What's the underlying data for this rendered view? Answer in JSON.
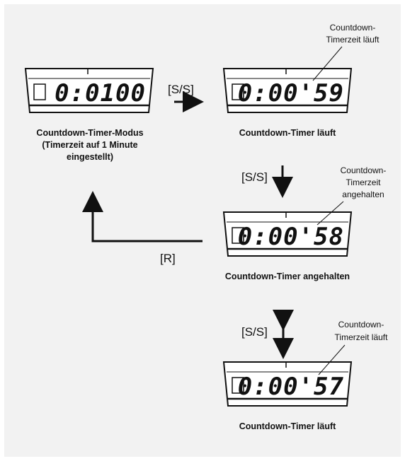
{
  "displays": [
    {
      "id": "d1",
      "time": "0:0100"
    },
    {
      "id": "d2",
      "time": "0:00'59"
    },
    {
      "id": "d3",
      "time": "0:00'58"
    },
    {
      "id": "d4",
      "time": "0:00'57"
    }
  ],
  "captions": {
    "mode_line1": "Countdown-Timer-Modus",
    "mode_line2": "(Timerzeit auf 1 Minute",
    "mode_line3": "eingestellt)",
    "running1": "Countdown-Timer läuft",
    "stopped": "Countdown-Timer angehalten",
    "running2": "Countdown-Timer läuft"
  },
  "button_labels": {
    "ss_right": "[S/S]",
    "ss_down": "[S/S]",
    "ss_updown": "[S/S]",
    "reset": "[R]"
  },
  "callouts": {
    "c1_line1": "Countdown-",
    "c1_line2": "Timerzeit läuft",
    "c2_line1": "Countdown-",
    "c2_line2": "Timerzeit",
    "c2_line3": "angehalten",
    "c3_line1": "Countdown-",
    "c3_line2": "Timerzeit läuft"
  }
}
